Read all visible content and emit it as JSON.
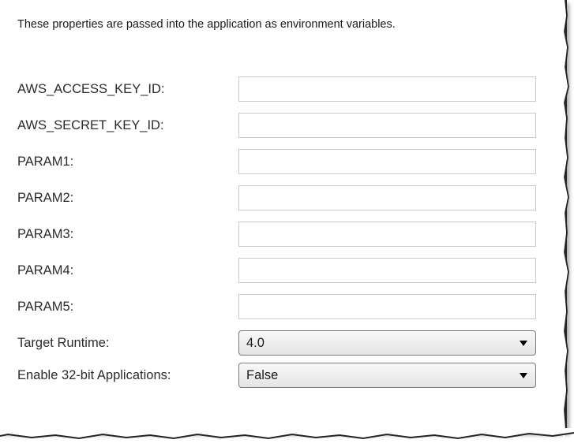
{
  "description": "These properties are passed into the application as environment variables.",
  "fields": [
    {
      "label": "AWS_ACCESS_KEY_ID:",
      "value": ""
    },
    {
      "label": "AWS_SECRET_KEY_ID:",
      "value": ""
    },
    {
      "label": "PARAM1:",
      "value": ""
    },
    {
      "label": "PARAM2:",
      "value": ""
    },
    {
      "label": "PARAM3:",
      "value": ""
    },
    {
      "label": "PARAM4:",
      "value": ""
    },
    {
      "label": "PARAM5:",
      "value": ""
    }
  ],
  "selects": [
    {
      "label": "Target Runtime:",
      "value": "4.0"
    },
    {
      "label": "Enable 32-bit Applications:",
      "value": "False"
    }
  ],
  "icons": {
    "dropdown": "chevron-down-icon"
  }
}
